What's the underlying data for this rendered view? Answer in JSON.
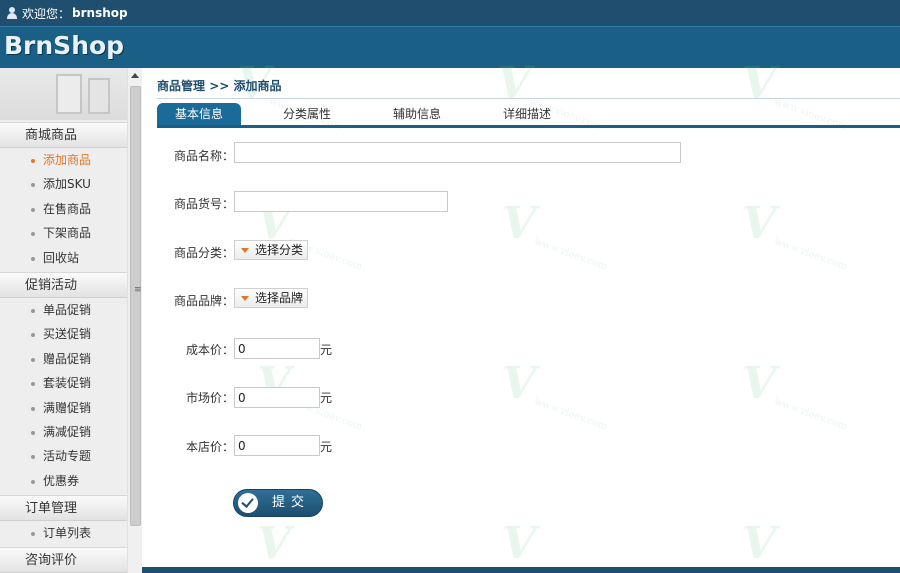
{
  "topbar": {
    "welcome": "欢迎您：",
    "username": "brnshop"
  },
  "header": {
    "logo": "BrnShop"
  },
  "sidebar": {
    "groups": [
      {
        "title": "商城商品",
        "items": [
          "添加商品",
          "添加SKU",
          "在售商品",
          "下架商品",
          "回收站"
        ]
      },
      {
        "title": "促销活动",
        "items": [
          "单品促销",
          "买送促销",
          "赠品促销",
          "套装促销",
          "满赠促销",
          "满减促销",
          "活动专题",
          "优惠券"
        ]
      },
      {
        "title": "订单管理",
        "items": [
          "订单列表"
        ]
      },
      {
        "title": "咨询评价",
        "items": []
      }
    ],
    "active_item": "添加商品"
  },
  "breadcrumb": {
    "parent": "商品管理",
    "separator": ">>",
    "current": "添加商品"
  },
  "tabs": [
    "基本信息",
    "分类属性",
    "辅助信息",
    "详细描述"
  ],
  "active_tab": "基本信息",
  "form": {
    "name_label": "商品名称：",
    "name_value": "",
    "sn_label": "商品货号：",
    "sn_value": "",
    "category_label": "商品分类：",
    "category_button": "选择分类",
    "brand_label": "商品品牌：",
    "brand_button": "选择品牌",
    "cost_label": "成本价：",
    "cost_value": "0",
    "market_label": "市场价：",
    "market_value": "0",
    "shop_label": "本店价：",
    "shop_value": "0",
    "unit": "元",
    "submit_label": "提交"
  },
  "watermark": {
    "mark": "V",
    "sub": "www.vioev.com"
  },
  "colors": {
    "brand": "#1a5f86",
    "topbar": "#1f4e6e",
    "accent": "#e0782a"
  }
}
